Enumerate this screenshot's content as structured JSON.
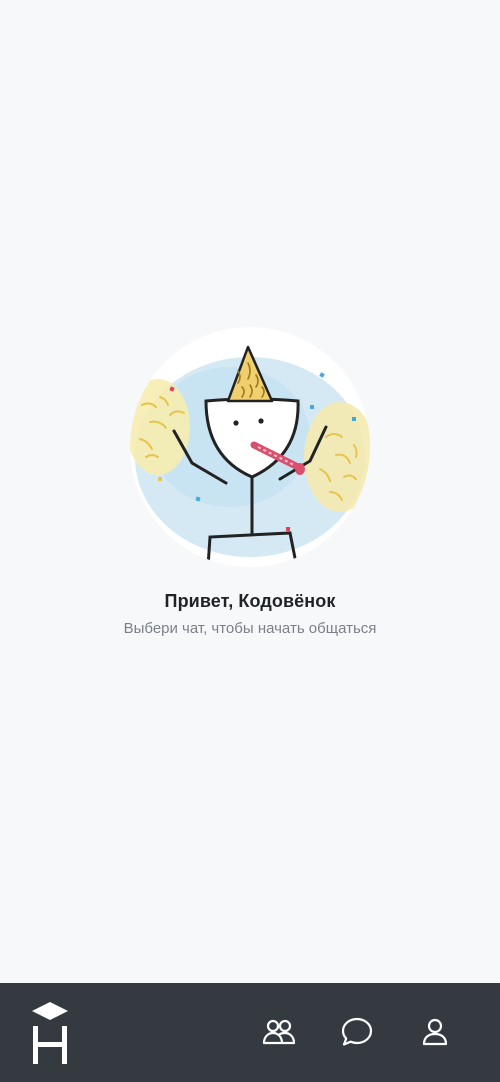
{
  "empty_state": {
    "title": "Привет, Кодовёнок",
    "subtitle": "Выбери чат, чтобы начать общаться"
  },
  "bottom_nav": {
    "logo": "app-logo-h",
    "items": [
      {
        "icon": "group-icon"
      },
      {
        "icon": "chat-bubble-icon"
      },
      {
        "icon": "user-icon"
      }
    ]
  },
  "colors": {
    "background": "#f7f8fa",
    "nav_background": "#353a41",
    "nav_icon": "#ffffff",
    "title": "#1f2328",
    "subtitle": "#7b8088"
  }
}
